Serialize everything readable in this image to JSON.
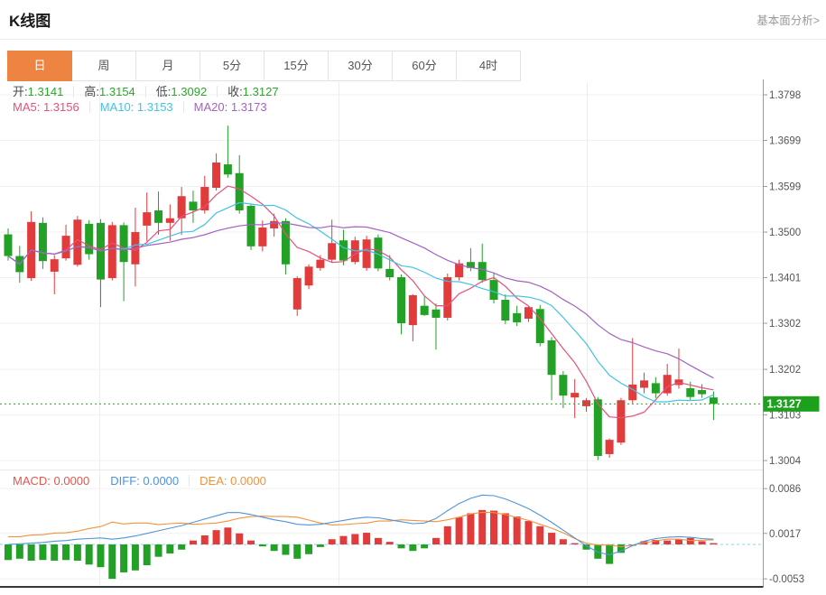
{
  "header": {
    "title": "K线图",
    "analysis_link": "基本面分析>"
  },
  "tabs": {
    "items": [
      "日",
      "周",
      "月",
      "5分",
      "15分",
      "30分",
      "60分",
      "4时"
    ],
    "active_index": 0,
    "active_color": "#ee8442"
  },
  "kline_legend": {
    "ohlc": [
      {
        "label": "开:",
        "value": "1.3141"
      },
      {
        "label": "高:",
        "value": "1.3154"
      },
      {
        "label": "低:",
        "value": "1.3092"
      },
      {
        "label": "收:",
        "value": "1.3127"
      }
    ],
    "value_color": "#2aa62a",
    "ma": [
      {
        "text": "MA5: 1.3156",
        "color": "#e5517e"
      },
      {
        "text": "MA10: 1.3153",
        "color": "#41c3e4"
      },
      {
        "text": "MA20: 1.3173",
        "color": "#a263c2"
      }
    ]
  },
  "macd_legend": [
    {
      "text": "MACD: 0.0000",
      "color": "#e2574e"
    },
    {
      "text": "DIFF: 0.0000",
      "color": "#4a93e0"
    },
    {
      "text": "DEA: 0.0000",
      "color": "#f0923c"
    }
  ],
  "y_axis": {
    "main_ticks": [
      "1.3798",
      "1.3699",
      "1.3599",
      "1.3500",
      "1.3401",
      "1.3302",
      "1.3202",
      "1.3103",
      "1.3004"
    ],
    "macd_ticks": [
      "0.0086",
      "0.0017",
      "-0.0053"
    ],
    "last_price": "1.3127"
  },
  "chart_data": {
    "type": "candlestick+macd",
    "title": "K线图 (daily)",
    "up_color": "#e23b3c",
    "down_color": "#22a126",
    "badge_color": "#1da11d",
    "last_price_line_color": "#2ca52a",
    "ma_periods": [
      5,
      10,
      20
    ],
    "ma_colors": [
      "#e5517e",
      "#41c3e4",
      "#a263c2"
    ],
    "diff_color": "#5094d8",
    "dea_color": "#f2923e",
    "price_ticks": [
      1.3798,
      1.3699,
      1.3599,
      1.35,
      1.3401,
      1.3302,
      1.3202,
      1.3103,
      1.3004
    ],
    "macd_ticks": [
      0.0086,
      0.0017,
      -0.0053
    ],
    "last_close": 1.3127,
    "candles": [
      [
        1.3495,
        1.3508,
        1.3438,
        1.3448
      ],
      [
        1.3448,
        1.347,
        1.339,
        1.3413
      ],
      [
        1.34,
        1.3545,
        1.3394,
        1.3522
      ],
      [
        1.352,
        1.3532,
        1.342,
        1.3437
      ],
      [
        1.3414,
        1.345,
        1.3365,
        1.3441
      ],
      [
        1.3443,
        1.3516,
        1.3438,
        1.3492
      ],
      [
        1.3429,
        1.3535,
        1.3425,
        1.3527
      ],
      [
        1.3518,
        1.3526,
        1.344,
        1.3452
      ],
      [
        1.352,
        1.3528,
        1.3337,
        1.3397
      ],
      [
        1.34,
        1.3522,
        1.3395,
        1.3515
      ],
      [
        1.3515,
        1.3521,
        1.335,
        1.3435
      ],
      [
        1.343,
        1.3553,
        1.3382,
        1.35
      ],
      [
        1.3514,
        1.3586,
        1.348,
        1.3543
      ],
      [
        1.3547,
        1.3588,
        1.3494,
        1.352
      ],
      [
        1.352,
        1.356,
        1.3481,
        1.353
      ],
      [
        1.353,
        1.3598,
        1.3494,
        1.3578
      ],
      [
        1.3566,
        1.359,
        1.352,
        1.3547
      ],
      [
        1.3547,
        1.3622,
        1.354,
        1.3598
      ],
      [
        1.3596,
        1.3671,
        1.359,
        1.3651
      ],
      [
        1.3647,
        1.3731,
        1.3618,
        1.3625
      ],
      [
        1.3628,
        1.3667,
        1.354,
        1.3547
      ],
      [
        1.3557,
        1.356,
        1.3461,
        1.3469
      ],
      [
        1.3469,
        1.3525,
        1.3458,
        1.351
      ],
      [
        1.3508,
        1.354,
        1.349,
        1.3524
      ],
      [
        1.3524,
        1.353,
        1.3408,
        1.343
      ],
      [
        1.3332,
        1.3404,
        1.3318,
        1.34
      ],
      [
        1.3384,
        1.343,
        1.3376,
        1.3425
      ],
      [
        1.3422,
        1.345,
        1.3416,
        1.344
      ],
      [
        1.344,
        1.3527,
        1.3434,
        1.3476
      ],
      [
        1.3482,
        1.3505,
        1.3428,
        1.3438
      ],
      [
        1.3435,
        1.349,
        1.343,
        1.3482
      ],
      [
        1.3422,
        1.3492,
        1.3416,
        1.3484
      ],
      [
        1.3488,
        1.3495,
        1.3415,
        1.3421
      ],
      [
        1.342,
        1.345,
        1.3395,
        1.3402
      ],
      [
        1.3402,
        1.3408,
        1.3278,
        1.3302
      ],
      [
        1.3298,
        1.3365,
        1.3263,
        1.3363
      ],
      [
        1.334,
        1.336,
        1.3318,
        1.332
      ],
      [
        1.3332,
        1.3345,
        1.3245,
        1.3314
      ],
      [
        1.3314,
        1.341,
        1.3308,
        1.3402
      ],
      [
        1.3402,
        1.344,
        1.3395,
        1.3432
      ],
      [
        1.3435,
        1.3465,
        1.3415,
        1.3422
      ],
      [
        1.3435,
        1.3475,
        1.339,
        1.3396
      ],
      [
        1.3396,
        1.341,
        1.3345,
        1.3353
      ],
      [
        1.3353,
        1.3365,
        1.33,
        1.3308
      ],
      [
        1.3324,
        1.334,
        1.3296,
        1.3304
      ],
      [
        1.3312,
        1.334,
        1.3305,
        1.3337
      ],
      [
        1.3333,
        1.3342,
        1.3252,
        1.3259
      ],
      [
        1.3265,
        1.3272,
        1.3135,
        1.319
      ],
      [
        1.319,
        1.3198,
        1.3118,
        1.3145
      ],
      [
        1.3141,
        1.3181,
        1.3096,
        1.3151
      ],
      [
        1.3122,
        1.314,
        1.311,
        1.3135
      ],
      [
        1.3137,
        1.3142,
        1.3005,
        1.3014
      ],
      [
        1.3018,
        1.3052,
        1.301,
        1.3049
      ],
      [
        1.3043,
        1.314,
        1.3038,
        1.3135
      ],
      [
        1.3135,
        1.327,
        1.3128,
        1.3169
      ],
      [
        1.3162,
        1.3195,
        1.315,
        1.3178
      ],
      [
        1.3172,
        1.3185,
        1.314,
        1.315
      ],
      [
        1.315,
        1.3214,
        1.3145,
        1.319
      ],
      [
        1.3168,
        1.3247,
        1.316,
        1.318
      ],
      [
        1.3161,
        1.3175,
        1.3135,
        1.3142
      ],
      [
        1.3157,
        1.317,
        1.314,
        1.3148
      ],
      [
        1.3141,
        1.3154,
        1.3092,
        1.3127
      ]
    ],
    "macd": {
      "diff": [
        0.0,
        0.0001,
        0.0002,
        0.0003,
        0.0005,
        0.0006,
        0.0008,
        0.0009,
        0.001,
        0.0008,
        0.001,
        0.0013,
        0.0017,
        0.0021,
        0.0025,
        0.0029,
        0.0034,
        0.0039,
        0.0044,
        0.0049,
        0.0049,
        0.0046,
        0.0042,
        0.0038,
        0.0035,
        0.0031,
        0.003,
        0.0031,
        0.0034,
        0.0037,
        0.004,
        0.0042,
        0.0041,
        0.0038,
        0.0035,
        0.0032,
        0.0033,
        0.004,
        0.0052,
        0.0063,
        0.0071,
        0.0076,
        0.0075,
        0.007,
        0.0063,
        0.0055,
        0.0045,
        0.0034,
        0.0022,
        0.001,
        -0.0002,
        -0.0012,
        -0.0016,
        -0.001,
        -0.0002,
        0.0005,
        0.0009,
        0.0011,
        0.0012,
        0.0011,
        0.0009,
        0.0008
      ],
      "hist": [
        -0.0024,
        -0.0022,
        -0.0025,
        -0.0024,
        -0.0025,
        -0.0024,
        -0.0025,
        -0.0031,
        -0.0035,
        -0.0053,
        -0.0043,
        -0.004,
        -0.0032,
        -0.0019,
        -0.0014,
        -0.0008,
        0.0006,
        0.0014,
        0.0022,
        0.0026,
        0.0017,
        0.0006,
        -0.0003,
        -0.001,
        -0.0016,
        -0.0022,
        -0.0015,
        -0.0004,
        0.0008,
        0.0013,
        0.0016,
        0.0018,
        0.001,
        0.0004,
        -0.0006,
        -0.001,
        -0.0006,
        0.001,
        0.0028,
        0.0042,
        0.0048,
        0.0053,
        0.0052,
        0.0048,
        0.0043,
        0.0036,
        0.0028,
        0.0018,
        0.0008,
        0.0002,
        -0.0008,
        -0.0022,
        -0.003,
        -0.0013,
        -0.0002,
        0.0005,
        0.0007,
        0.0006,
        0.0008,
        0.001,
        0.0005,
        0.0002
      ]
    }
  }
}
